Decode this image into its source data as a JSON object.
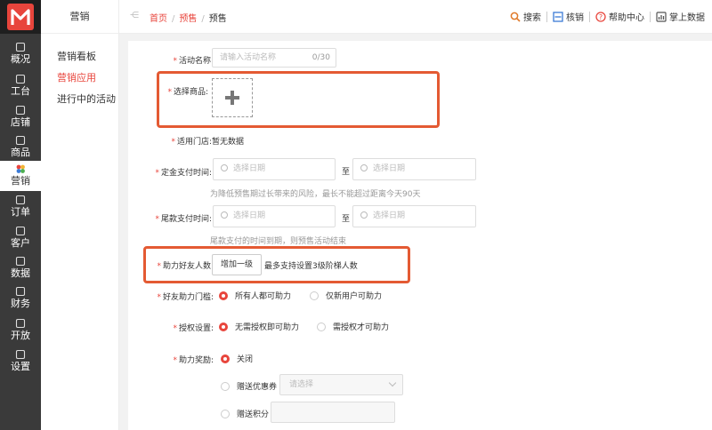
{
  "nav": {
    "items": [
      {
        "label": "概况",
        "icon": "overview-icon"
      },
      {
        "label": "工台",
        "icon": "desk-icon"
      },
      {
        "label": "店铺",
        "icon": "store-icon"
      },
      {
        "label": "商品",
        "icon": "goods-icon"
      },
      {
        "label": "营销",
        "icon": "marketing-icon"
      },
      {
        "label": "订单",
        "icon": "order-icon"
      },
      {
        "label": "客户",
        "icon": "customer-icon"
      },
      {
        "label": "数据",
        "icon": "data-icon"
      },
      {
        "label": "财务",
        "icon": "finance-icon"
      },
      {
        "label": "开放",
        "icon": "open-icon"
      },
      {
        "label": "设置",
        "icon": "settings-icon"
      }
    ]
  },
  "sub": {
    "title": "营销",
    "items": [
      "营销看板",
      "营销应用",
      "进行中的活动"
    ]
  },
  "top": {
    "breadcrumb": [
      "首页",
      "预售",
      "预售"
    ],
    "tools": [
      "搜索",
      "核销",
      "帮助中心",
      "掌上数据"
    ]
  },
  "form": {
    "name_label": "活动名称:",
    "name_placeholder": "请输入活动名称",
    "name_count": "0/30",
    "goods_label": "选择商品:",
    "store_label": "适用门店:",
    "store_value": "暂无数据",
    "deposit_label": "定金支付时间:",
    "date_placeholder": "选择日期",
    "to": "至",
    "deposit_hint": "为降低预售期过长带来的风险，最长不能超过距离今天90天",
    "final_label": "尾款支付时间:",
    "final_hint": "尾款支付的时间到期，则预售活动结束",
    "friends_label": "助力好友人数:",
    "add_level": "增加一级",
    "friends_hint": "最多支持设置3级阶梯人数",
    "threshold_label": "好友助力门槛:",
    "threshold_opt1": "所有人都可助力",
    "threshold_opt2": "仅新用户可助力",
    "auth_label": "授权设置:",
    "auth_opt1": "无需授权即可助力",
    "auth_opt2": "需授权才可助力",
    "reward_label": "助力奖励:",
    "reward_off": "关闭",
    "reward_coupon": "赠送优惠券",
    "coupon_placeholder": "请选择",
    "reward_points": "赠送积分"
  },
  "colors": {
    "accent": "#e8453c",
    "highlight": "#e45a33",
    "nav_bg": "#3a3a3a"
  }
}
